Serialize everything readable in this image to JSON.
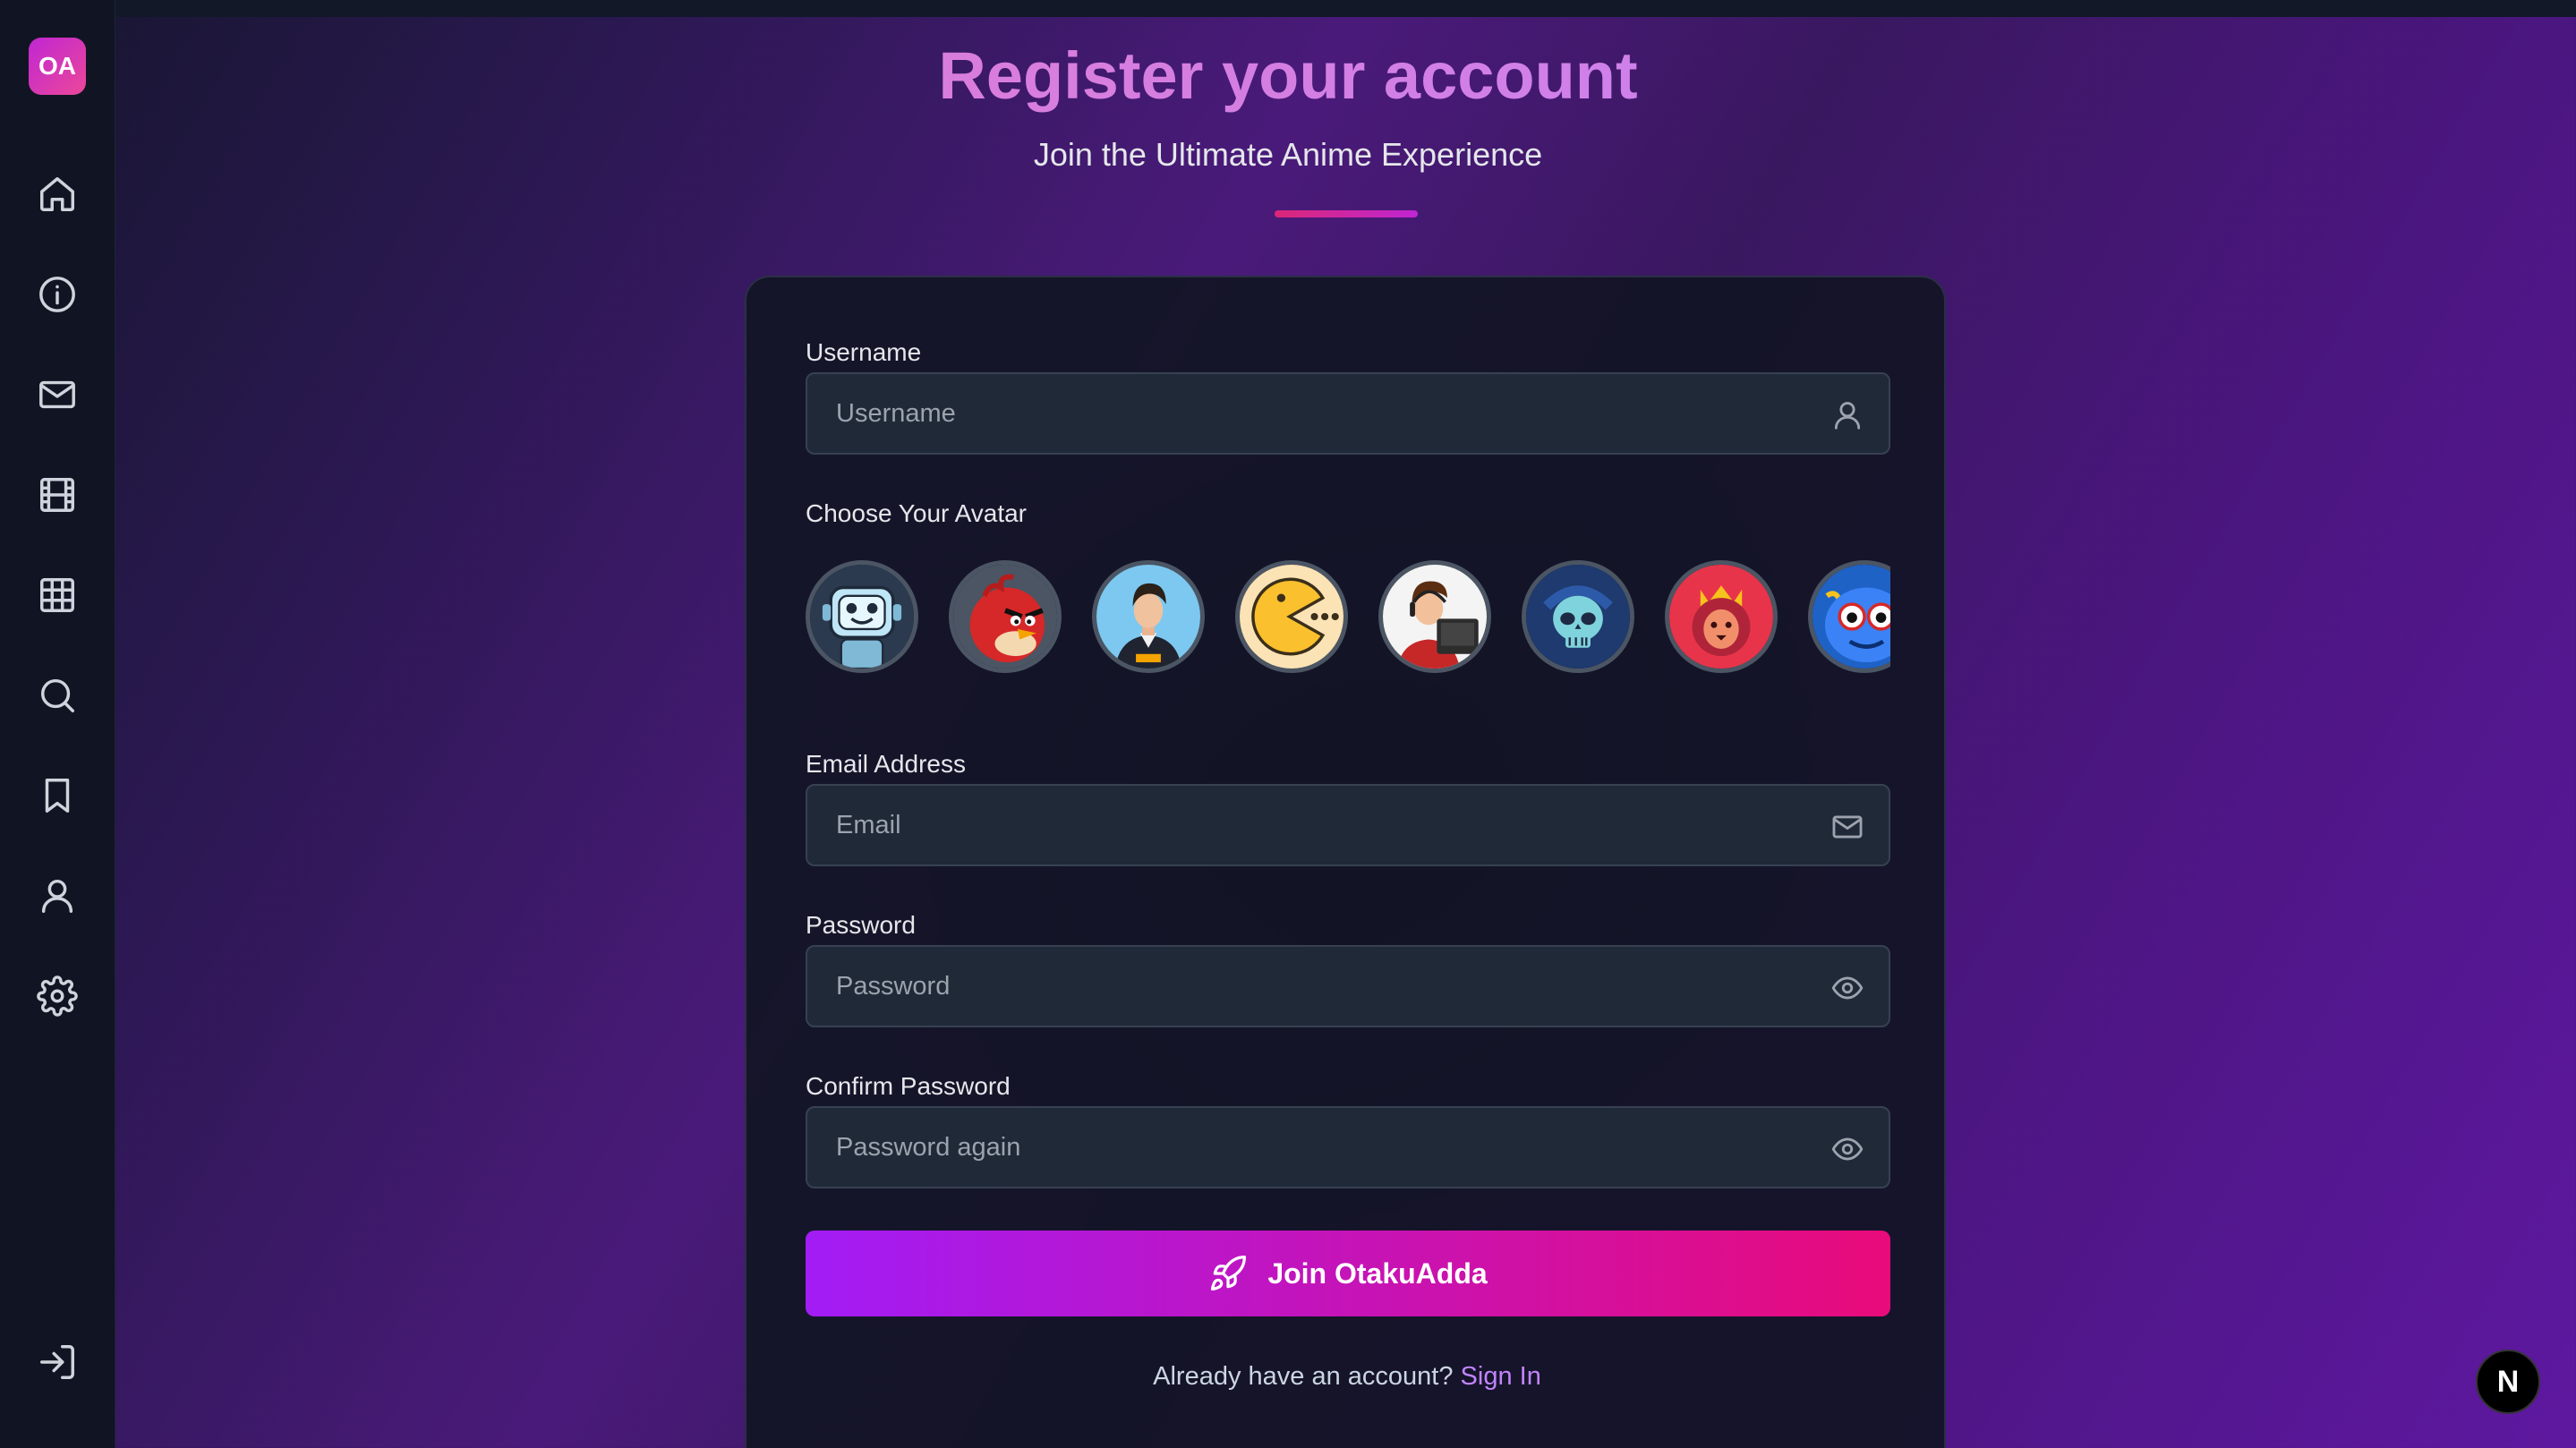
{
  "app": {
    "logo_text": "OA",
    "dev_badge": "N"
  },
  "sidebar": {
    "items": [
      {
        "name": "home",
        "icon": "home-icon"
      },
      {
        "name": "about",
        "icon": "info-icon"
      },
      {
        "name": "contact",
        "icon": "mail-icon"
      },
      {
        "name": "movies",
        "icon": "film-icon"
      },
      {
        "name": "grid",
        "icon": "grid-icon"
      },
      {
        "name": "search",
        "icon": "search-icon"
      },
      {
        "name": "bookmarks",
        "icon": "bookmark-icon"
      },
      {
        "name": "profile",
        "icon": "user-icon"
      },
      {
        "name": "settings",
        "icon": "gear-icon"
      }
    ],
    "footer_icon": "login-icon"
  },
  "header": {
    "title": "Register your account",
    "subtitle": "Join the Ultimate Anime Experience"
  },
  "form": {
    "username": {
      "label": "Username",
      "placeholder": "Username",
      "icon": "user-icon"
    },
    "avatar": {
      "label": "Choose Your Avatar",
      "options": [
        "robot-avatar",
        "angry-bird-avatar",
        "man-avatar",
        "pacman-avatar",
        "gamer-avatar",
        "skull-avatar",
        "lion-king-avatar",
        "blue-monster-avatar"
      ]
    },
    "email": {
      "label": "Email Address",
      "placeholder": "Email",
      "icon": "mail-icon"
    },
    "password": {
      "label": "Password",
      "placeholder": "Password",
      "icon": "eye-icon"
    },
    "confirm_password": {
      "label": "Confirm Password",
      "placeholder": "Password again",
      "icon": "eye-icon"
    },
    "submit_label": "Join OtakuAdda",
    "submit_icon": "rocket-icon",
    "signin_prompt": "Already have an account?",
    "signin_link": "Sign In"
  },
  "colors": {
    "accent_pink": "#e80b7a",
    "accent_purple": "#a21cf5",
    "link": "#c084fc",
    "card_bg": "#111524",
    "input_bg": "#1f2937"
  }
}
